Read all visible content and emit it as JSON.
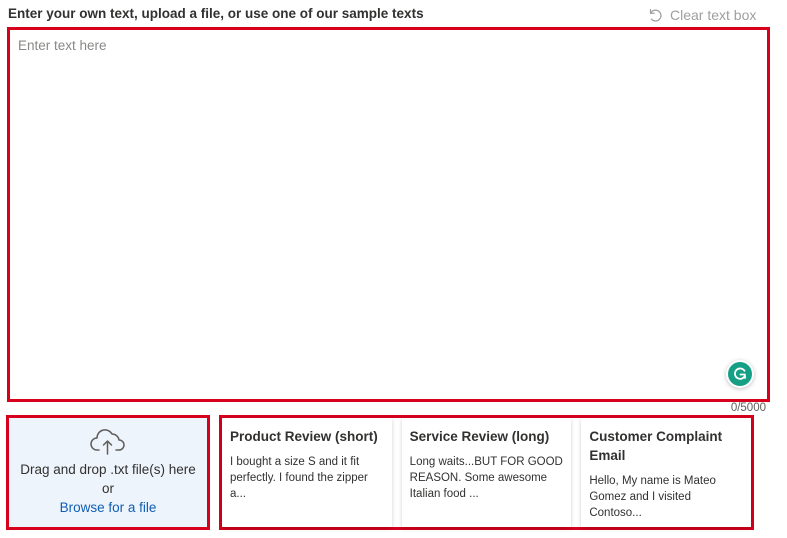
{
  "header": {
    "label": "Enter your own text, upload a file, or use one of our sample texts",
    "clear_label": "Clear text box",
    "clear_icon": "undo-icon"
  },
  "textbox": {
    "placeholder": "Enter text here",
    "value": "",
    "char_count": "0/5000",
    "grammarly_icon": "grammarly-icon"
  },
  "dropzone": {
    "icon": "cloud-upload-icon",
    "line1": "Drag and drop .txt file(s) here",
    "line2": "or",
    "browse_label": "Browse for a file"
  },
  "samples": [
    {
      "title": "Product Review (short)",
      "body": "I bought a size S and it fit perfectly. I found the zipper a..."
    },
    {
      "title": "Service Review (long)",
      "body": "Long waits...BUT FOR GOOD REASON. Some awesome Italian food ..."
    },
    {
      "title": "Customer Complaint Email",
      "body": "Hello, My name is Mateo Gomez and I visited Contoso..."
    }
  ],
  "colors": {
    "highlight_border": "#d6001c",
    "link": "#0f5db5",
    "dropzone_bg": "#eef4fb",
    "grammarly": "#15a085"
  }
}
